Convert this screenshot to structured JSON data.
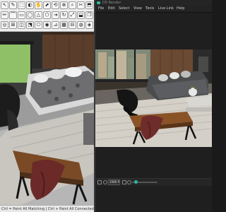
{
  "left_app": {
    "toolbar_row1": [
      "↖",
      "✎",
      "⬚",
      "◐",
      "✋",
      "⬈",
      "⟲",
      "⊕",
      "⌕",
      "✂",
      "⬒",
      "⚙",
      "⎘"
    ],
    "toolbar_row2": [
      "✏",
      "⌒",
      "▭",
      "◯",
      "△",
      "⬡",
      "⇥",
      "↻",
      "⤢",
      "⬓",
      "❐"
    ],
    "toolbar_row3": [
      "◎",
      "⊞",
      "◫",
      "⬔",
      "⎔",
      "◉",
      "⊿",
      "▦",
      "⊟",
      "◍",
      "◈",
      "⌗"
    ],
    "status_text": "Ctrl = Paint All Matching | Ctrl + Paint All Connected | Shift + Ctrl = Paint All on Same Object"
  },
  "right_app": {
    "title": "D5 Render",
    "menu": [
      "File",
      "Edit",
      "Select",
      "View",
      "Tools",
      "Live Link",
      "Help"
    ],
    "resolution": "1080 P"
  },
  "colors": {
    "accent": "#2fb59a",
    "left_ui": "#eeeeee",
    "right_ui": "#1f1f1f"
  }
}
